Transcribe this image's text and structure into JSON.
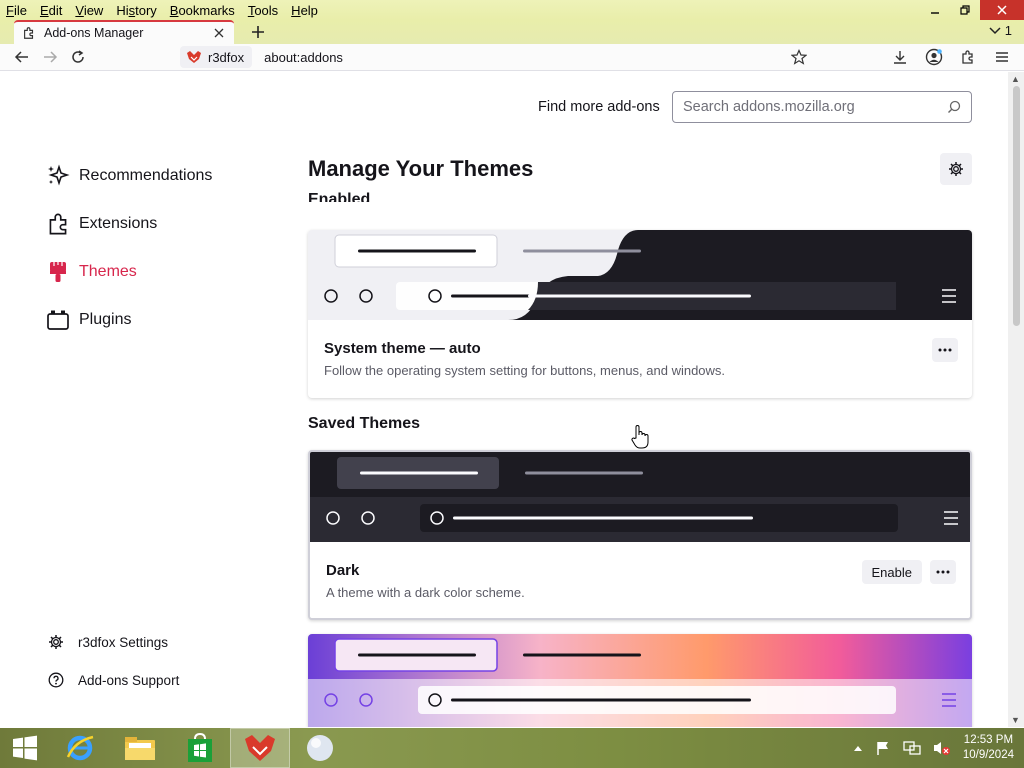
{
  "menu": [
    "File",
    "Edit",
    "View",
    "History",
    "Bookmarks",
    "Tools",
    "Help"
  ],
  "menu_accel": [
    "F",
    "E",
    "V",
    "s",
    "B",
    "T",
    "H"
  ],
  "tab": {
    "title": "Add-ons Manager"
  },
  "tablist_count": "1",
  "identity": {
    "label": "r3dfox"
  },
  "url": "about:addons",
  "find_more": "Find more add-ons",
  "search": {
    "placeholder": "Search addons.mozilla.org"
  },
  "sidebar": {
    "items": [
      {
        "label": "Recommendations",
        "icon": "sparkle-icon"
      },
      {
        "label": "Extensions",
        "icon": "puzzle-icon"
      },
      {
        "label": "Themes",
        "icon": "brush-icon",
        "active": true
      },
      {
        "label": "Plugins",
        "icon": "plugin-icon"
      }
    ],
    "footer": [
      {
        "label": "r3dfox Settings",
        "icon": "gear-icon"
      },
      {
        "label": "Add-ons Support",
        "icon": "help-icon"
      }
    ]
  },
  "main": {
    "heading": "Manage Your Themes",
    "enabled_heading": "Enabled",
    "saved_heading": "Saved Themes",
    "themes": [
      {
        "name": "System theme — auto",
        "description": "Follow the operating system setting for buttons, menus, and windows."
      },
      {
        "name": "Dark",
        "description": "A theme with a dark color scheme.",
        "enable_label": "Enable"
      },
      {
        "name": "",
        "description": ""
      }
    ]
  },
  "taskbar": {
    "clock_time": "12:53 PM",
    "clock_date": "10/9/2024"
  },
  "colors": {
    "accent": "#d7264c",
    "menubar": "#eaeeae",
    "dark_preview": "#1c1b22"
  }
}
